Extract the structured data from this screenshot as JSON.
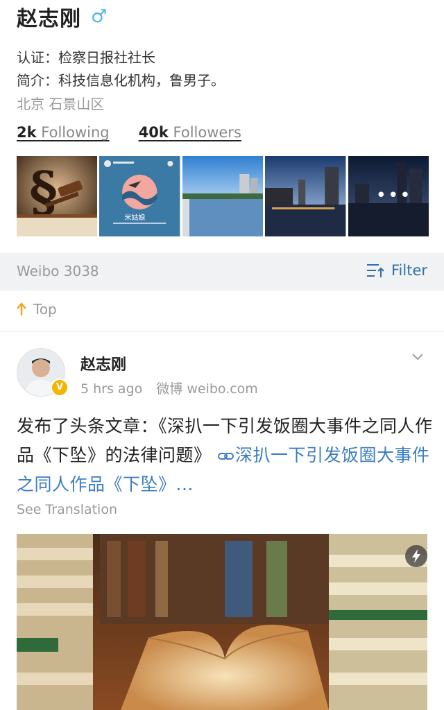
{
  "profile": {
    "name": "赵志刚",
    "gender_symbol": "♂",
    "verification": "认证：检察日报社社长",
    "bio": "简介：科技信息化机构，鲁男子。",
    "location": "北京 石景山区",
    "following_count": "2k",
    "following_label": "Following",
    "followers_count": "40k",
    "followers_label": "Followers"
  },
  "album": {
    "thumb_badge_title": "米姑娘"
  },
  "tabbar": {
    "weibo_count": "Weibo 3038",
    "filter_label": "Filter"
  },
  "top_label": "Top",
  "post": {
    "author": "赵志刚",
    "time": "5 hrs ago",
    "source": "微博 weibo.com",
    "text": "发布了头条文章：《深扒一下引发饭圈大事件之同人作品《下坠》的法律问题》",
    "link_text": "深扒一下引发饭圈大事件之同人作品《下坠》...",
    "see_translation": "See Translation"
  },
  "colors": {
    "accent_blue": "#3b7dc4",
    "filter_blue": "#2f6ea8",
    "gender_blue": "#4fb3e8",
    "badge_gold": "#f6b400",
    "top_arrow": "#f5a623"
  }
}
